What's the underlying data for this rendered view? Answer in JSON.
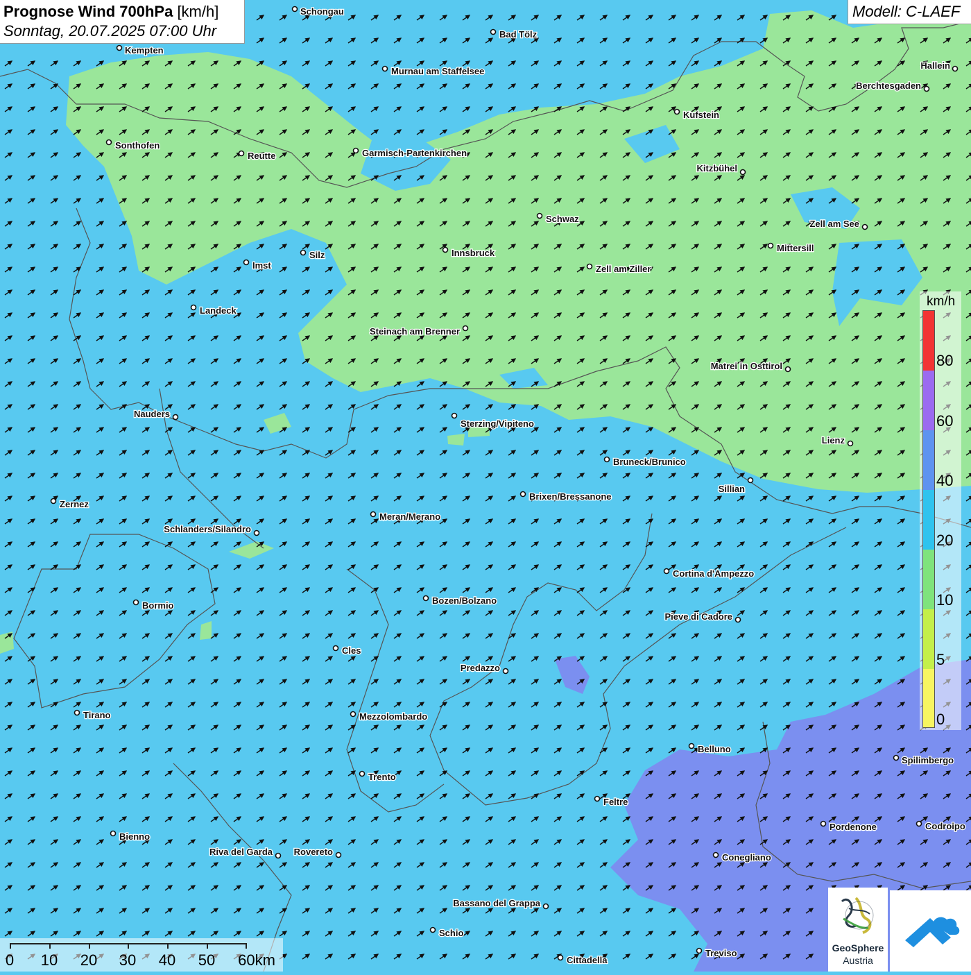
{
  "header": {
    "title_bold": "Prognose Wind 700hPa",
    "title_unit": "[km/h]",
    "datetime": "Sonntag, 20.07.2025 07:00 Uhr",
    "model": "Modell: C-LAEF"
  },
  "legend": {
    "unit": "km/h",
    "ticks": [
      "80",
      "60",
      "40",
      "20",
      "10",
      "5",
      "0"
    ],
    "colors": [
      "#f23434",
      "#9b6bf0",
      "#5e93f0",
      "#2fc3ee",
      "#7fe37c",
      "#c4ef4a",
      "#f7f560"
    ]
  },
  "scale_bar": {
    "labels": [
      "0",
      "10",
      "20",
      "30",
      "40",
      "50",
      "60km"
    ]
  },
  "logo": {
    "name_line1": "GeoSphere",
    "name_line2": "Austria"
  },
  "colors": {
    "background_low": "#58c9f0",
    "band_10_20": "#9ae69a",
    "band_20_40": "#58c9f0",
    "band_40_60": "#7b8ff0",
    "border": "#555555",
    "arrow": "#111111"
  },
  "wind_direction": "south-west to north-east",
  "cities": [
    {
      "name": "Schongau"
    },
    {
      "name": "Bad Tölz"
    },
    {
      "name": "Kempten"
    },
    {
      "name": "Murnau am Staffelsee"
    },
    {
      "name": "Hallein"
    },
    {
      "name": "Berchtesgaden"
    },
    {
      "name": "Kufstein"
    },
    {
      "name": "Sonthofen"
    },
    {
      "name": "Reutte"
    },
    {
      "name": "Garmisch-Partenkirchen"
    },
    {
      "name": "Kitzbühel"
    },
    {
      "name": "Schwaz"
    },
    {
      "name": "Zell am See"
    },
    {
      "name": "Mittersill"
    },
    {
      "name": "Innsbruck"
    },
    {
      "name": "Silz"
    },
    {
      "name": "Imst"
    },
    {
      "name": "Zell am Ziller"
    },
    {
      "name": "Landeck"
    },
    {
      "name": "Steinach am Brenner"
    },
    {
      "name": "Matrei in Osttirol"
    },
    {
      "name": "Nauders"
    },
    {
      "name": "Sterzing/Vipiteno"
    },
    {
      "name": "Lienz"
    },
    {
      "name": "Bruneck/Brunico"
    },
    {
      "name": "Sillian"
    },
    {
      "name": "Zernez"
    },
    {
      "name": "Brixen/Bressanone"
    },
    {
      "name": "Meran/Merano"
    },
    {
      "name": "Schlanders/Silandro"
    },
    {
      "name": "Cortina d'Ampezzo"
    },
    {
      "name": "Bozen/Bolzano"
    },
    {
      "name": "Bormio"
    },
    {
      "name": "Pieve di Cadore"
    },
    {
      "name": "Cles"
    },
    {
      "name": "Predazzo"
    },
    {
      "name": "Tirano"
    },
    {
      "name": "Mezzolombardo"
    },
    {
      "name": "Belluno"
    },
    {
      "name": "Spilimbergo"
    },
    {
      "name": "Trento"
    },
    {
      "name": "Feltre"
    },
    {
      "name": "Bienno"
    },
    {
      "name": "Pordenone"
    },
    {
      "name": "Codroipo"
    },
    {
      "name": "Riva del Garda"
    },
    {
      "name": "Rovereto"
    },
    {
      "name": "Conegliano"
    },
    {
      "name": "Bassano del Grappa"
    },
    {
      "name": "Schio"
    },
    {
      "name": "Treviso"
    },
    {
      "name": "Cittadella"
    }
  ]
}
